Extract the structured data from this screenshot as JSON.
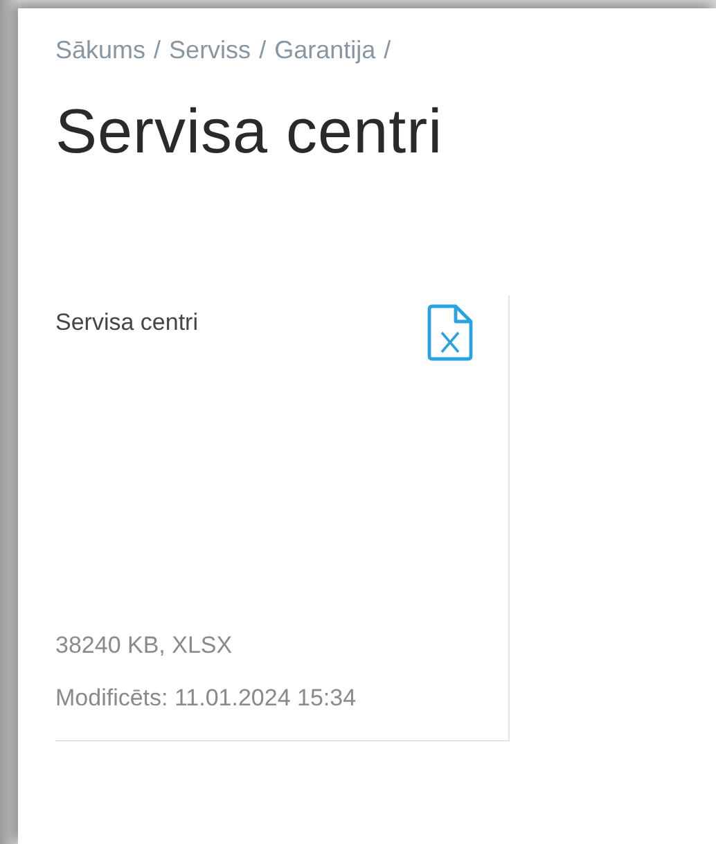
{
  "breadcrumb": [
    {
      "label": "Sākums",
      "separator": "/"
    },
    {
      "label": "Serviss",
      "separator": "/"
    },
    {
      "label": "Garantija",
      "separator": "/"
    }
  ],
  "title": "Servisa centri",
  "files": [
    {
      "kind": "xlsx",
      "name": "Servisa centri",
      "size": "38240 KB, XLSX",
      "modified": "Modificēts: 11.01.2024 15:34"
    }
  ]
}
